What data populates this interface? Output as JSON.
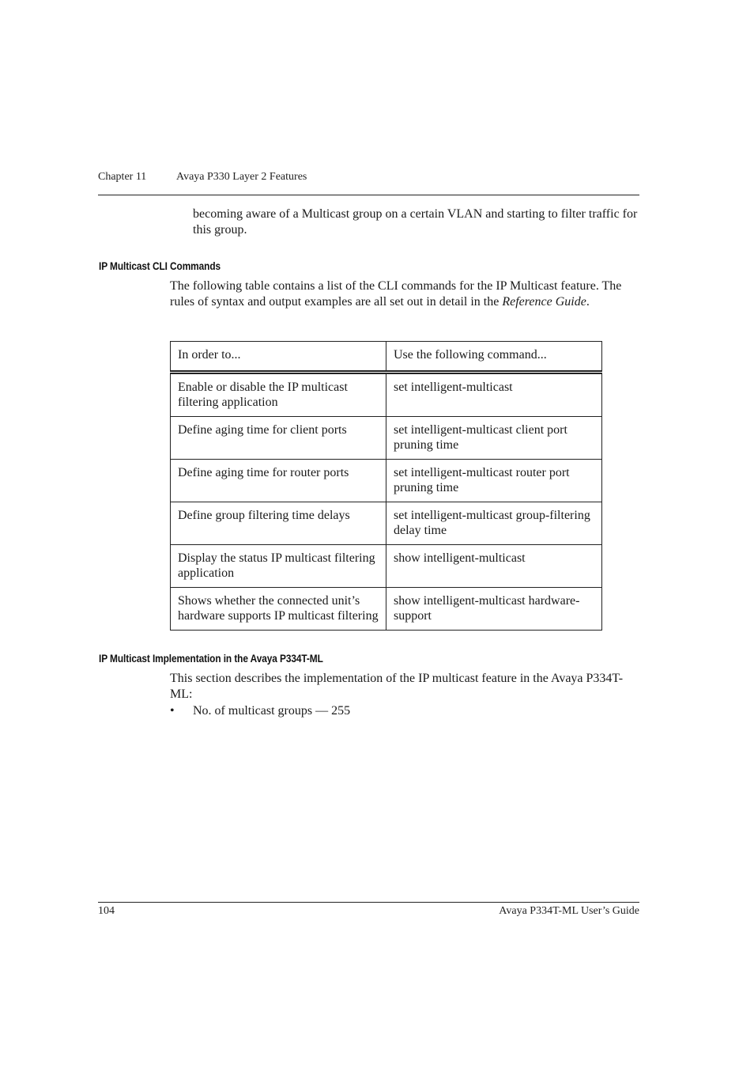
{
  "running_header": {
    "chapter": "Chapter 11",
    "title": "Avaya P330 Layer 2 Features"
  },
  "intro_paragraph": "becoming aware of a Multicast group on a certain VLAN and starting to filter traffic for this group.",
  "section_cli": {
    "heading": "IP Multicast CLI Commands",
    "paragraph_before_italic": "The following table contains a list of the CLI commands for the IP Multicast feature. The rules of syntax and output examples are all set out in detail in the ",
    "paragraph_italic": "Reference Guide",
    "paragraph_after_italic": ".",
    "table": {
      "headers": [
        "In order to...",
        "Use the following command..."
      ],
      "rows": [
        [
          "Enable or disable the IP multicast filtering application",
          "set intelligent-multicast"
        ],
        [
          "Define aging time for client ports",
          "set intelligent-multicast client port pruning time"
        ],
        [
          "Define aging time for router ports",
          "set intelligent-multicast router port pruning time"
        ],
        [
          "Define group filtering time delays",
          "set intelligent-multicast group-filtering delay time"
        ],
        [
          "Display the status IP multicast filtering application",
          "show intelligent-multicast"
        ],
        [
          "Shows whether the connected unit’s hardware supports IP multicast filtering",
          "show intelligent-multicast hardware-support"
        ]
      ]
    }
  },
  "section_impl": {
    "heading": "IP Multicast Implementation in the Avaya P334T-ML",
    "paragraph": "This section describes the implementation of the IP multicast feature in the Avaya P334T-ML:",
    "bullet_symbol": "•",
    "bullets": [
      "No. of multicast groups — 255"
    ]
  },
  "footer": {
    "page_number": "104",
    "guide_title": "Avaya P334T-ML User’s Guide"
  }
}
